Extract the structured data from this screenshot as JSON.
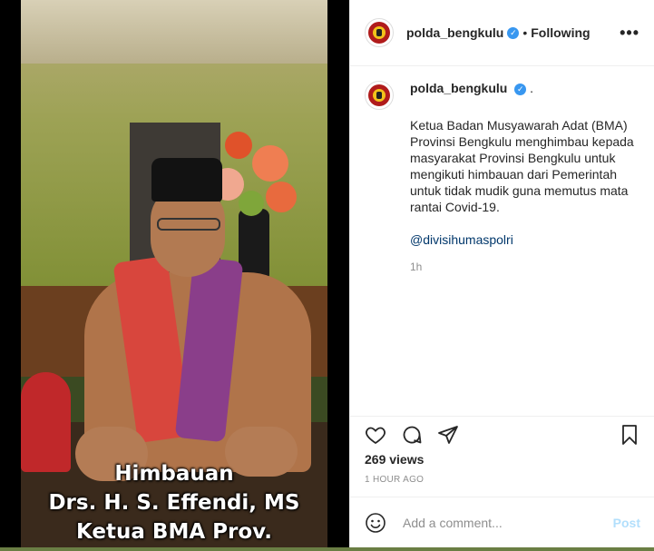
{
  "post": {
    "username": "polda_bengkulu",
    "follow_separator": "•",
    "follow_status": "Following",
    "more_label": "•••"
  },
  "video": {
    "caption_lines": [
      "Himbauan",
      "Drs. H. S. Effendi, MS",
      "Ketua BMA Prov. Bengkulu"
    ]
  },
  "comment": {
    "username": "polda_bengkulu",
    "trailing": ".",
    "text": "Ketua Badan Musyawarah Adat (BMA) Provinsi Bengkulu menghimbau kepada masyarakat Provinsi Bengkulu untuk mengikuti himbauan dari Pemerintah untuk tidak mudik guna memutus mata rantai Covid-19.",
    "mention": "@divisihumaspolri",
    "time": "1h"
  },
  "stats": {
    "views": "269 views",
    "timestamp": "1 HOUR AGO"
  },
  "add_comment": {
    "placeholder": "Add a comment...",
    "post_label": "Post"
  },
  "icons": {
    "like": "heart-icon",
    "comment": "comment-icon",
    "share": "share-icon",
    "save": "bookmark-icon",
    "emoji": "emoji-icon",
    "verified": "verified-badge-icon"
  },
  "colors": {
    "verified": "#3897f0",
    "link": "#00376b",
    "post_disabled": "#b2dffc",
    "muted": "#8e8e8e"
  }
}
